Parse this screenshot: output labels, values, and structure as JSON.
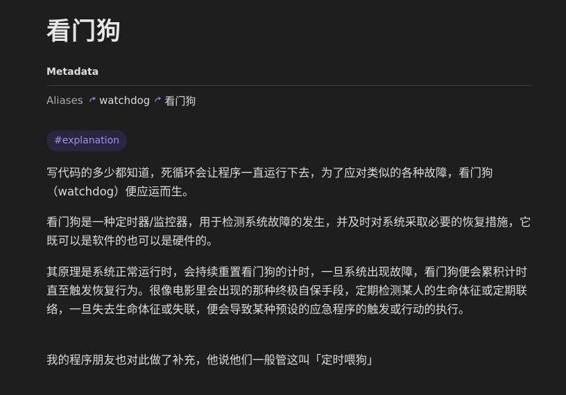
{
  "note": {
    "title": "看门狗"
  },
  "metadata": {
    "heading": "Metadata",
    "aliases_key": "Aliases",
    "aliases": [
      "watchdog",
      "看门狗"
    ]
  },
  "tag": "#explanation",
  "paragraphs": [
    "写代码的多少都知道，死循环会让程序一直运行下去，为了应对类似的各种故障，看门狗（watchdog）便应运而生。",
    "看门狗是一种定时器/监控器，用于检测系统故障的发生，并及时对系统采取必要的恢复措施，它既可以是软件的也可以是硬件的。",
    "其原理是系统正常运行时，会持续重置看门狗的计时，一旦系统出现故障，看门狗便会累积计时直至触发恢复行为。很像电影里会出现的那种终极自保手段，定期检测某人的生命体征或定期联络，一旦失去生命体征或失联，便会导致某种预设的应急程序的触发或行动的执行。",
    "我的程序朋友也对此做了补充，他说他们一般管这叫「定时喂狗」"
  ],
  "icons": {
    "alias_icon": "alias-link-arrow-icon"
  },
  "colors": {
    "background": "#1e1e1e",
    "text": "#dadada",
    "accent": "#9f8ff0",
    "tag_background": "#2b2640"
  }
}
